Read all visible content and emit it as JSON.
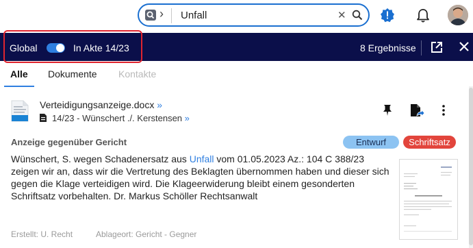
{
  "search": {
    "value": "Unfall"
  },
  "toolbar": {
    "scope_global": "Global",
    "scope_akte": "In Akte 14/23",
    "result_count": "8 Ergebnisse"
  },
  "tabs": [
    {
      "label": "Alle"
    },
    {
      "label": "Dokumente"
    },
    {
      "label": "Kontakte"
    }
  ],
  "result": {
    "title": "Verteidigungsanzeige.docx",
    "case": "14/23 - Wünschert ./. Kerstensen",
    "raquo": "»",
    "section": "Anzeige gegenüber Gericht",
    "badges": [
      "Entwurf",
      "Schriftsatz"
    ],
    "body": {
      "before": "Wünschert, S. wegen Schadenersatz aus ",
      "highlight": "Unfall",
      "after": " vom 01.05.2023   Az.: 104 C 388/23 zeigen wir an, dass wir die Vertretung des Beklagten übernommen haben und dieser sich gegen die Klage verteidigen wird. Die Klageerwiderung bleibt einem gesonderten Schriftsatz vorbehalten.     Dr. Markus Schöller   Rechtsanwalt"
    },
    "created": "Erstellt:  U. Recht",
    "storage": "Ablageort:  Gericht - Gegner"
  },
  "colors": {
    "accent": "#2f7fe0",
    "navbar": "#0b0f4a",
    "highlight_box": "#e0242f",
    "badge_draft": "#8cc3f2",
    "badge_type": "#e2453c"
  },
  "icons": [
    "search-scope-icon",
    "clear-icon",
    "search-icon",
    "alert-icon",
    "bell-icon",
    "avatar",
    "open-external-icon",
    "close-icon",
    "docx-file-icon",
    "case-file-icon",
    "pin-icon",
    "send-document-icon",
    "more-icon"
  ]
}
